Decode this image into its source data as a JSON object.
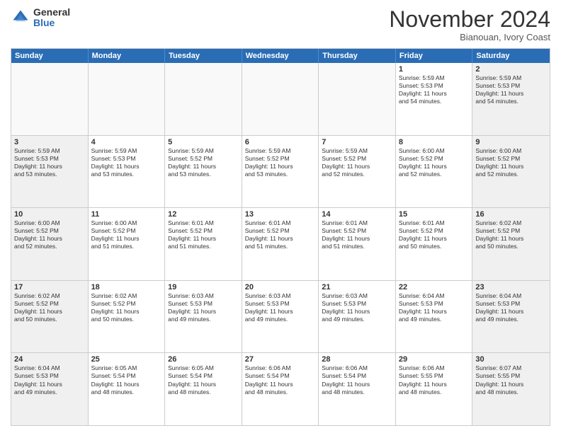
{
  "logo": {
    "general": "General",
    "blue": "Blue"
  },
  "title": "November 2024",
  "location": "Bianouan, Ivory Coast",
  "header_days": [
    "Sunday",
    "Monday",
    "Tuesday",
    "Wednesday",
    "Thursday",
    "Friday",
    "Saturday"
  ],
  "weeks": [
    [
      {
        "day": "",
        "text": "",
        "empty": true
      },
      {
        "day": "",
        "text": "",
        "empty": true
      },
      {
        "day": "",
        "text": "",
        "empty": true
      },
      {
        "day": "",
        "text": "",
        "empty": true
      },
      {
        "day": "",
        "text": "",
        "empty": true
      },
      {
        "day": "1",
        "text": "Sunrise: 5:59 AM\nSunset: 5:53 PM\nDaylight: 11 hours\nand 54 minutes.",
        "empty": false
      },
      {
        "day": "2",
        "text": "Sunrise: 5:59 AM\nSunset: 5:53 PM\nDaylight: 11 hours\nand 54 minutes.",
        "empty": false
      }
    ],
    [
      {
        "day": "3",
        "text": "Sunrise: 5:59 AM\nSunset: 5:53 PM\nDaylight: 11 hours\nand 53 minutes.",
        "empty": false
      },
      {
        "day": "4",
        "text": "Sunrise: 5:59 AM\nSunset: 5:53 PM\nDaylight: 11 hours\nand 53 minutes.",
        "empty": false
      },
      {
        "day": "5",
        "text": "Sunrise: 5:59 AM\nSunset: 5:52 PM\nDaylight: 11 hours\nand 53 minutes.",
        "empty": false
      },
      {
        "day": "6",
        "text": "Sunrise: 5:59 AM\nSunset: 5:52 PM\nDaylight: 11 hours\nand 53 minutes.",
        "empty": false
      },
      {
        "day": "7",
        "text": "Sunrise: 5:59 AM\nSunset: 5:52 PM\nDaylight: 11 hours\nand 52 minutes.",
        "empty": false
      },
      {
        "day": "8",
        "text": "Sunrise: 6:00 AM\nSunset: 5:52 PM\nDaylight: 11 hours\nand 52 minutes.",
        "empty": false
      },
      {
        "day": "9",
        "text": "Sunrise: 6:00 AM\nSunset: 5:52 PM\nDaylight: 11 hours\nand 52 minutes.",
        "empty": false
      }
    ],
    [
      {
        "day": "10",
        "text": "Sunrise: 6:00 AM\nSunset: 5:52 PM\nDaylight: 11 hours\nand 52 minutes.",
        "empty": false
      },
      {
        "day": "11",
        "text": "Sunrise: 6:00 AM\nSunset: 5:52 PM\nDaylight: 11 hours\nand 51 minutes.",
        "empty": false
      },
      {
        "day": "12",
        "text": "Sunrise: 6:01 AM\nSunset: 5:52 PM\nDaylight: 11 hours\nand 51 minutes.",
        "empty": false
      },
      {
        "day": "13",
        "text": "Sunrise: 6:01 AM\nSunset: 5:52 PM\nDaylight: 11 hours\nand 51 minutes.",
        "empty": false
      },
      {
        "day": "14",
        "text": "Sunrise: 6:01 AM\nSunset: 5:52 PM\nDaylight: 11 hours\nand 51 minutes.",
        "empty": false
      },
      {
        "day": "15",
        "text": "Sunrise: 6:01 AM\nSunset: 5:52 PM\nDaylight: 11 hours\nand 50 minutes.",
        "empty": false
      },
      {
        "day": "16",
        "text": "Sunrise: 6:02 AM\nSunset: 5:52 PM\nDaylight: 11 hours\nand 50 minutes.",
        "empty": false
      }
    ],
    [
      {
        "day": "17",
        "text": "Sunrise: 6:02 AM\nSunset: 5:52 PM\nDaylight: 11 hours\nand 50 minutes.",
        "empty": false
      },
      {
        "day": "18",
        "text": "Sunrise: 6:02 AM\nSunset: 5:52 PM\nDaylight: 11 hours\nand 50 minutes.",
        "empty": false
      },
      {
        "day": "19",
        "text": "Sunrise: 6:03 AM\nSunset: 5:53 PM\nDaylight: 11 hours\nand 49 minutes.",
        "empty": false
      },
      {
        "day": "20",
        "text": "Sunrise: 6:03 AM\nSunset: 5:53 PM\nDaylight: 11 hours\nand 49 minutes.",
        "empty": false
      },
      {
        "day": "21",
        "text": "Sunrise: 6:03 AM\nSunset: 5:53 PM\nDaylight: 11 hours\nand 49 minutes.",
        "empty": false
      },
      {
        "day": "22",
        "text": "Sunrise: 6:04 AM\nSunset: 5:53 PM\nDaylight: 11 hours\nand 49 minutes.",
        "empty": false
      },
      {
        "day": "23",
        "text": "Sunrise: 6:04 AM\nSunset: 5:53 PM\nDaylight: 11 hours\nand 49 minutes.",
        "empty": false
      }
    ],
    [
      {
        "day": "24",
        "text": "Sunrise: 6:04 AM\nSunset: 5:53 PM\nDaylight: 11 hours\nand 49 minutes.",
        "empty": false
      },
      {
        "day": "25",
        "text": "Sunrise: 6:05 AM\nSunset: 5:54 PM\nDaylight: 11 hours\nand 48 minutes.",
        "empty": false
      },
      {
        "day": "26",
        "text": "Sunrise: 6:05 AM\nSunset: 5:54 PM\nDaylight: 11 hours\nand 48 minutes.",
        "empty": false
      },
      {
        "day": "27",
        "text": "Sunrise: 6:06 AM\nSunset: 5:54 PM\nDaylight: 11 hours\nand 48 minutes.",
        "empty": false
      },
      {
        "day": "28",
        "text": "Sunrise: 6:06 AM\nSunset: 5:54 PM\nDaylight: 11 hours\nand 48 minutes.",
        "empty": false
      },
      {
        "day": "29",
        "text": "Sunrise: 6:06 AM\nSunset: 5:55 PM\nDaylight: 11 hours\nand 48 minutes.",
        "empty": false
      },
      {
        "day": "30",
        "text": "Sunrise: 6:07 AM\nSunset: 5:55 PM\nDaylight: 11 hours\nand 48 minutes.",
        "empty": false
      }
    ]
  ]
}
